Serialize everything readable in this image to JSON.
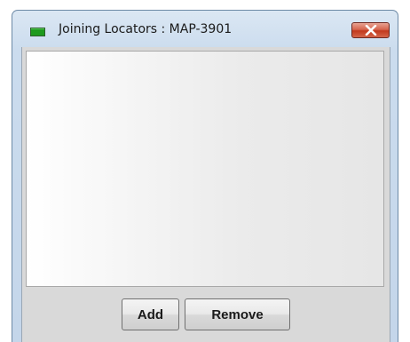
{
  "window": {
    "title": "Joining Locators : MAP-3901",
    "status_color": "#1e9a1e",
    "close_icon": "close-x"
  },
  "buttons": {
    "add_label": "Add",
    "remove_label": "Remove"
  },
  "list": {
    "items": []
  }
}
